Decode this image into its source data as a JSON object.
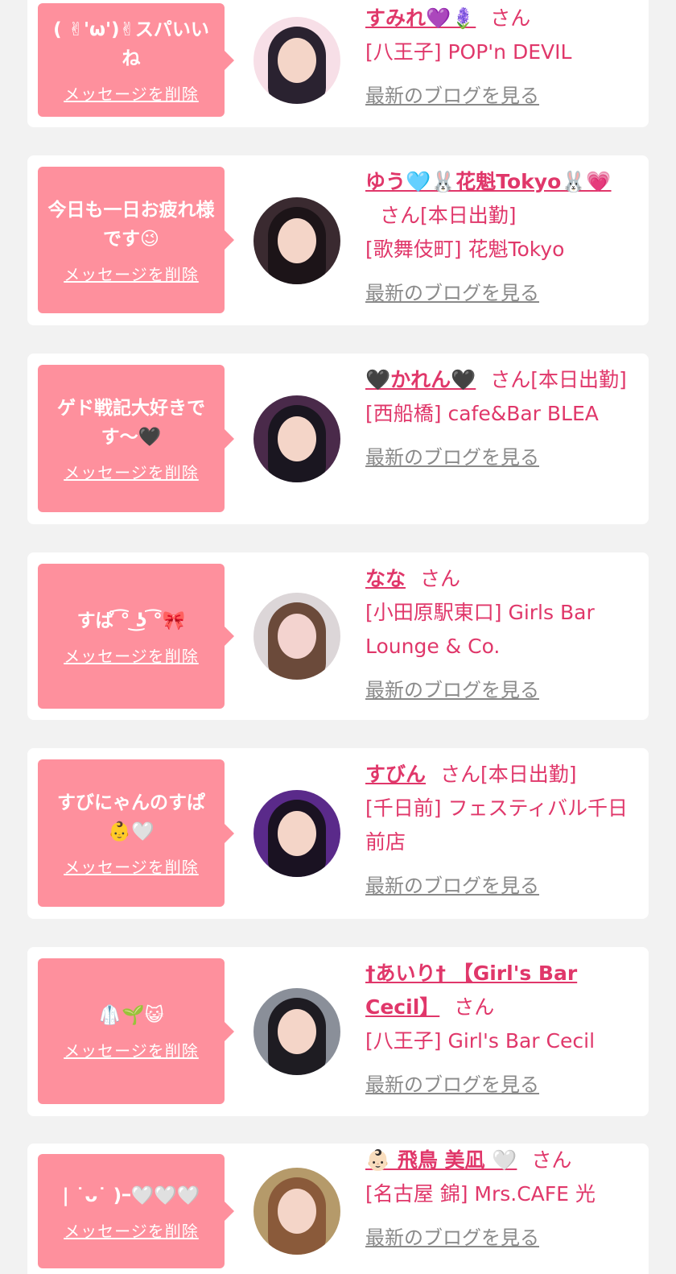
{
  "items": [
    {
      "message": "( ✌︎'ω')✌︎スパいいね",
      "delete_label": "メッセージを削除",
      "name": "すみれ💜🪻",
      "honorific": "さん",
      "status": "",
      "shop": "[八王子] POP'n DEVIL",
      "blog_label": "最新のブログを見る"
    },
    {
      "message": "今日も一日お疲れ様です😉",
      "delete_label": "メッセージを削除",
      "name": "ゆう🩵🐰花魁Tokyo🐰💗",
      "honorific": "さん",
      "status": "[本日出勤]",
      "shop": "[歌舞伎町] 花魁Tokyo",
      "blog_label": "最新のブログを見る"
    },
    {
      "message": "ゲド戦記大好きです〜🖤",
      "delete_label": "メッセージを削除",
      "name": "🖤かれん🖤",
      "honorific": "さん",
      "status": "[本日出勤]",
      "shop": "[西船橋] cafe&Bar BLEA",
      "blog_label": "最新のブログを見る"
    },
    {
      "message": "すぱ ͡° ͜ʖ ͡°🎀",
      "delete_label": "メッセージを削除",
      "name": "なな",
      "honorific": "さん",
      "status": "",
      "shop": "[小田原駅東口] Girls Bar Lounge & Co.",
      "blog_label": "最新のブログを見る"
    },
    {
      "message": "すびにゃんのすぱ👶🤍",
      "delete_label": "メッセージを削除",
      "name": "すびん",
      "honorific": "さん",
      "status": "[本日出勤]",
      "shop": "[千日前] フェスティバル千日前店",
      "blog_label": "最新のブログを見る"
    },
    {
      "message": "🥼🌱😺",
      "delete_label": "メッセージを削除",
      "name": "†あいり† 【Girl's Bar Cecil】",
      "honorific": "さん",
      "status": "",
      "shop": "[八王子] Girl's Bar Cecil",
      "blog_label": "最新のブログを見る"
    },
    {
      "message": "| ˙ᴗ˙ )ｰ🤍🤍🤍",
      "delete_label": "メッセージを削除",
      "name": "👶🏻 飛鳥 美凪 🤍",
      "honorific": "さん",
      "status": "",
      "shop": "[名古屋 錦] Mrs.CAFE 光",
      "blog_label": "最新のブログを見る"
    }
  ],
  "colors": {
    "bubble": "#fe909d",
    "accent": "#e0376a",
    "muted": "#8a8a8a",
    "background": "#f2f2f2"
  }
}
